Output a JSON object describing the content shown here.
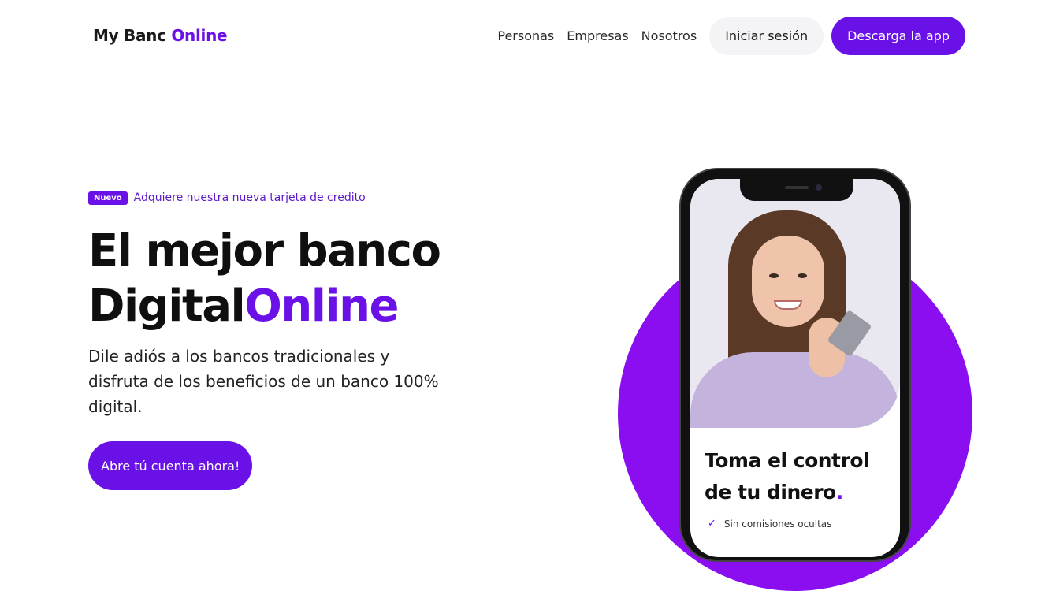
{
  "logo": {
    "part1": "My Banc ",
    "part2": "Online"
  },
  "nav": {
    "links": [
      "Personas",
      "Empresas",
      "Nosotros"
    ],
    "login": "Iniciar sesión",
    "download": "Descarga la app"
  },
  "hero": {
    "badge": "Nuevo",
    "badge_text": "Adquiere nuestra nueva tarjeta de credito",
    "title_line1": "El mejor banco",
    "title_line2a": "Digital",
    "title_line2b": "Online",
    "subtitle": "Dile adiós a los bancos tradicionales y disfruta de los beneficios de un banco 100% digital.",
    "cta": "Abre tú cuenta ahora!"
  },
  "phone": {
    "title_line1": "Toma el control",
    "title_line2": "de tu dinero",
    "title_dot": ".",
    "list_item": "Sin comisiones ocultas"
  },
  "colors": {
    "accent": "#6a11e8",
    "circle": "#8a0ef0"
  }
}
